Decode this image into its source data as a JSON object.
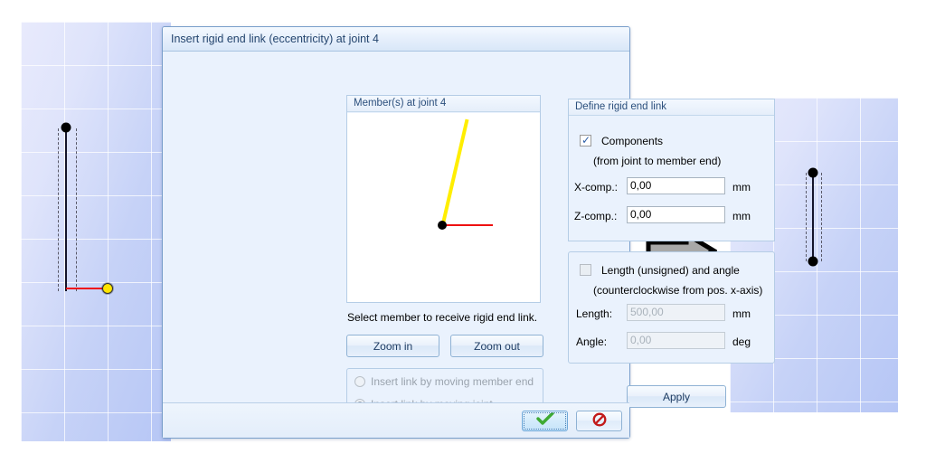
{
  "dialog": {
    "title": "Insert rigid end link (eccentricity) at joint 4",
    "members_group": {
      "header": "Member(s) at joint 4",
      "hint": "Select member to receive rigid end link.",
      "zoom_in_label": "Zoom in",
      "zoom_out_label": "Zoom out"
    },
    "insert_mode": {
      "option_member_end": "Insert link by moving member end",
      "option_joint": "Insert link by moving joint",
      "selected": "Insert link by moving joint"
    },
    "define_group": {
      "header": "Define rigid end link",
      "components_label": "Components",
      "components_checked": true,
      "components_sub": "(from joint to member end)",
      "x_label": "X-comp.:",
      "x_value": "0,00",
      "x_unit": "mm",
      "z_label": "Z-comp.:",
      "z_value": "0,00",
      "z_unit": "mm"
    },
    "length_angle_group": {
      "length_angle_label": "Length (unsigned) and angle",
      "length_angle_checked": false,
      "length_angle_sub": "(counterclockwise from pos. x-axis)",
      "length_label": "Length:",
      "length_value": "500,00",
      "length_unit": "mm",
      "angle_label": "Angle:",
      "angle_value": "0,00",
      "angle_unit": "deg"
    },
    "apply_label": "Apply",
    "ok_icon": "green-check-icon",
    "cancel_icon": "red-forbidden-icon"
  },
  "model_before": {
    "name": "model-canvas-before",
    "icons": [
      "joint-dot-icon",
      "eccentricity-line-icon",
      "selected-joint-node-icon"
    ]
  },
  "model_after": {
    "name": "model-canvas-after",
    "icons": [
      "joint-dot-icon"
    ]
  },
  "transition": {
    "icon": "right-arrow-icon"
  },
  "member_preview": {
    "icons": [
      "yellow-member-icon",
      "red-eccentricity-icon",
      "joint-dot-icon"
    ]
  },
  "colors": {
    "accent": "#2b4f7c",
    "member_selected": "#ffee00",
    "eccentricity": "#ee1111",
    "node": "#ffe400",
    "canvas_bg": "#c6d2f7"
  }
}
